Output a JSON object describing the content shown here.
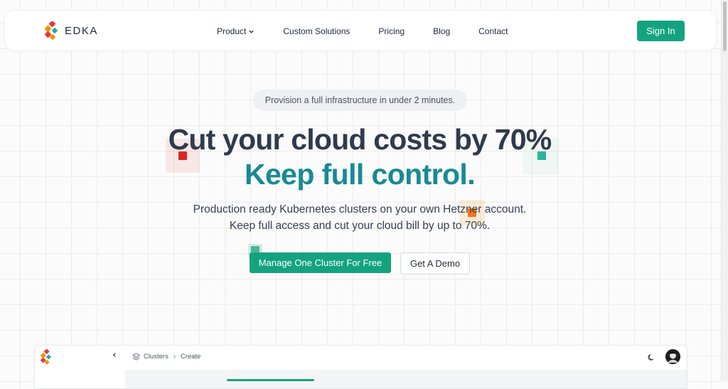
{
  "nav": {
    "brand": "EDKA",
    "links": [
      "Product",
      "Custom Solutions",
      "Pricing",
      "Blog",
      "Contact"
    ],
    "sign_in": "Sign In"
  },
  "hero": {
    "pill": "Provision a full infrastructure in under 2 minutes.",
    "headline_1": "Cut your cloud costs by 70%",
    "headline_2": "Keep full control.",
    "sub_1": "Production ready Kubernetes clusters on your own Hetzner account.",
    "sub_2": "Keep full access and cut your cloud bill by up to 70%.",
    "cta_primary": "Manage One Cluster For Free",
    "cta_secondary": "Get A Demo"
  },
  "preview": {
    "breadcrumb": [
      "Clusters",
      "Create"
    ],
    "icons": [
      "layers-icon",
      "chevron-left-icon",
      "moon-icon",
      "avatar"
    ]
  },
  "colors": {
    "accent": "#14a37f",
    "headline_dark": "#2f3b4c",
    "headline_teal": "#178a96",
    "logo_red": "#e53935",
    "logo_orange": "#fb8c00",
    "logo_teal": "#1fa99a"
  }
}
